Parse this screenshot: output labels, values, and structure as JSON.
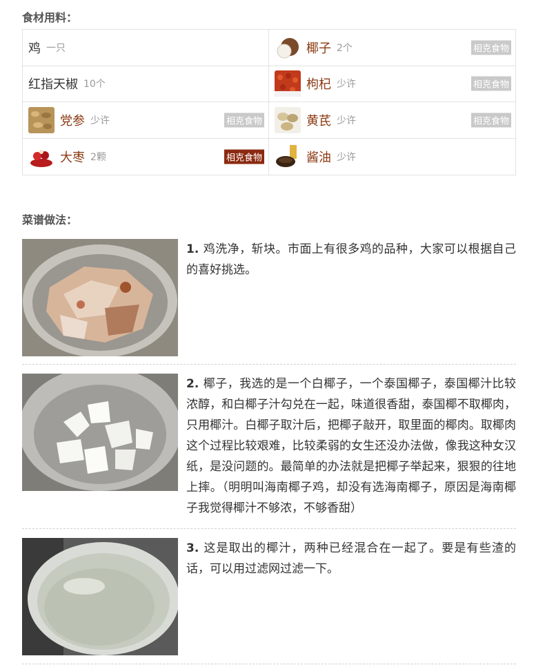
{
  "ingredients_title": "食材用料：",
  "steps_title": "菜谱做法：",
  "ingredients": [
    {
      "name": "鸡",
      "amount": "一只",
      "tag": ""
    },
    {
      "name": "椰子",
      "amount": "2个",
      "tag": "相克食物",
      "tag_active": false
    },
    {
      "name": "红指天椒",
      "amount": "10个",
      "tag": ""
    },
    {
      "name": "枸杞",
      "amount": "少许",
      "tag": "相克食物",
      "tag_active": false
    },
    {
      "name": "党参",
      "amount": "少许",
      "tag": "相克食物",
      "tag_active": false
    },
    {
      "name": "黄芪",
      "amount": "少许",
      "tag": "相克食物",
      "tag_active": false
    },
    {
      "name": "大枣",
      "amount": "2颗",
      "tag": "相克食物",
      "tag_active": true
    },
    {
      "name": "酱油",
      "amount": "少许",
      "tag": ""
    }
  ],
  "steps": [
    {
      "num": "1.",
      "text": "鸡洗净，斩块。市面上有很多鸡的品种，大家可以根据自己的喜好挑选。"
    },
    {
      "num": "2.",
      "text": "椰子，我选的是一个白椰子，一个泰国椰子，泰国椰汁比较浓醇，和白椰子汁勾兑在一起，味道很香甜，泰国椰不取椰肉，只用椰汁。白椰子取汁后，把椰子敲开，取里面的椰肉。取椰肉这个过程比较艰难，比较柔弱的女生还没办法做，像我这种女汉纸，是没问题的。最简单的办法就是把椰子举起来，狠狠的往地上摔。（明明叫海南椰子鸡，却没有选海南椰子，原因是海南椰子我觉得椰汁不够浓，不够香甜）"
    },
    {
      "num": "3.",
      "text": "这是取出的椰汁，两种已经混合在一起了。要是有些渣的话，可以用过滤网过滤一下。"
    }
  ]
}
